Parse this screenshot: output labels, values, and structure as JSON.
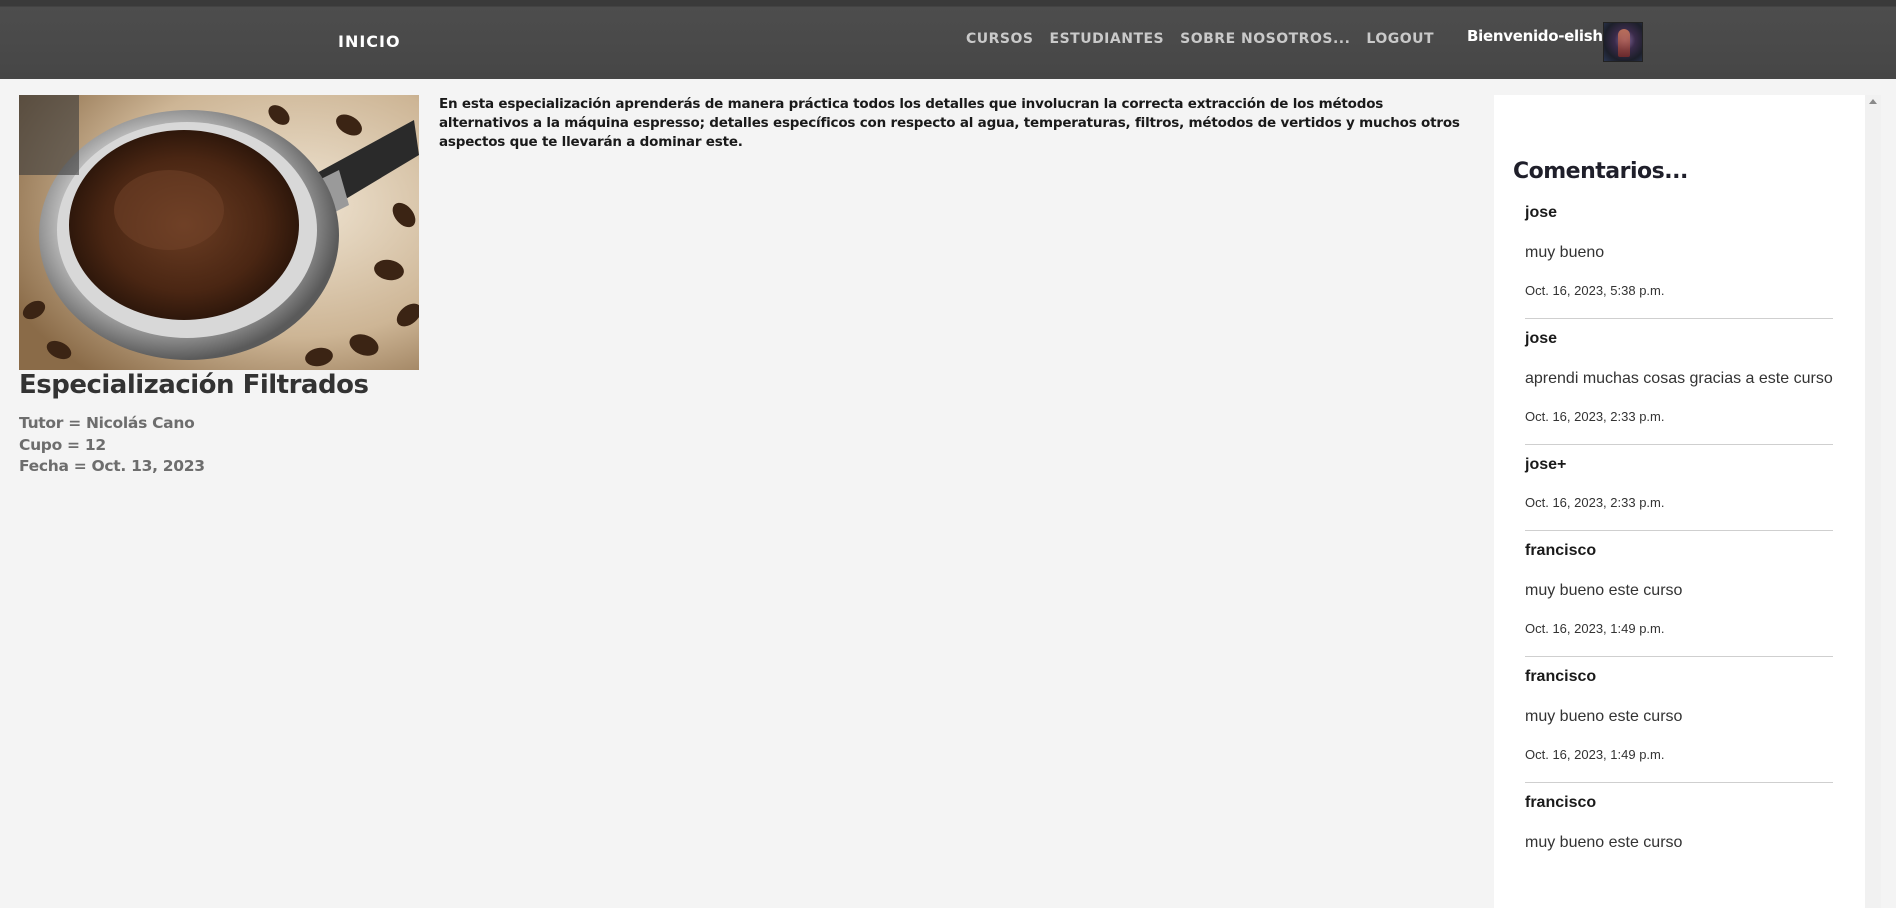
{
  "navbar": {
    "brand": "INICIO",
    "links": [
      "CURSOS",
      "ESTUDIANTES",
      "SOBRE NOSOTROS...",
      "LOGOUT"
    ],
    "welcome": "Bienvenido-elisho"
  },
  "course": {
    "title": "Especialización Filtrados",
    "tutor": "Tutor = Nicolás Cano",
    "cupo": "Cupo = 12",
    "fecha": "Fecha = Oct. 13, 2023",
    "description": "En esta especialización aprenderás de manera práctica todos los detalles que involucran la correcta extracción de los métodos alternativos a la máquina espresso; detalles específicos con respecto al agua, temperaturas, filtros, métodos de vertidos y muchos otros aspectos que te llevarán a dominar este."
  },
  "comments": {
    "title": "Comentarios...",
    "items": [
      {
        "author": "jose",
        "text": "muy bueno",
        "date": "Oct. 16, 2023, 5:38 p.m."
      },
      {
        "author": "jose",
        "text": "aprendi muchas cosas gracias a este curso",
        "date": "Oct. 16, 2023, 2:33 p.m."
      },
      {
        "author": "jose+",
        "text": "",
        "date": "Oct. 16, 2023, 2:33 p.m."
      },
      {
        "author": "francisco",
        "text": "muy bueno este curso",
        "date": "Oct. 16, 2023, 1:49 p.m."
      },
      {
        "author": "francisco",
        "text": "muy bueno este curso",
        "date": "Oct. 16, 2023, 1:49 p.m."
      },
      {
        "author": "francisco",
        "text": "muy bueno este curso",
        "date": ""
      }
    ]
  },
  "colors": {
    "navbar": "#464646",
    "page_background": "#f4f4f4",
    "panel_background": "#ffffff"
  }
}
